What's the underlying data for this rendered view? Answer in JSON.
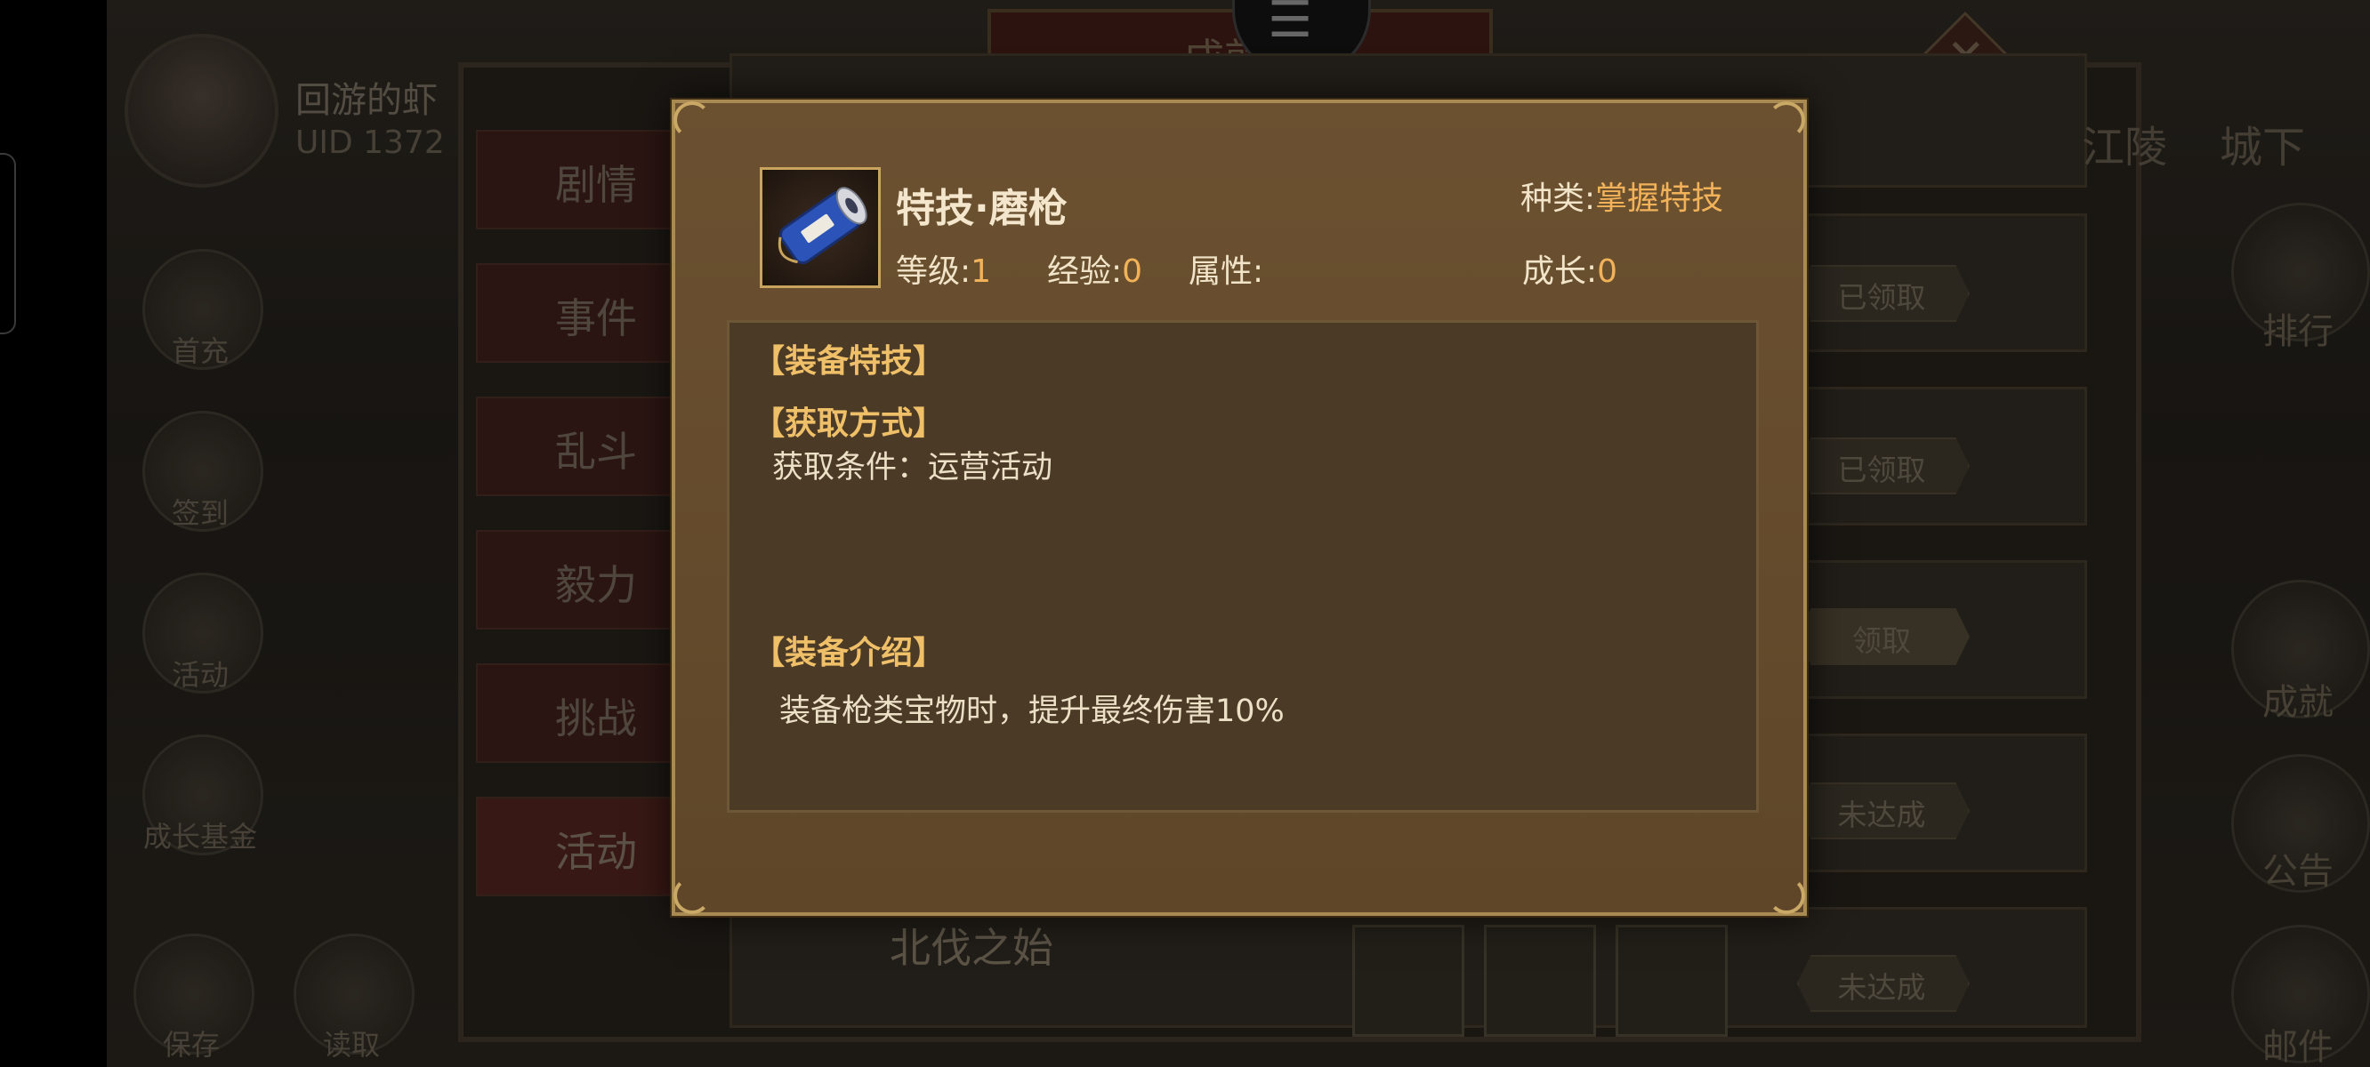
{
  "background": {
    "player": {
      "name": "回游的虾",
      "uid": "UID  1372"
    },
    "window_title": "成就",
    "tabs": [
      "剧情",
      "事件",
      "乱斗",
      "毅力",
      "挑战",
      "活动"
    ],
    "left_icons": [
      "首充",
      "签到",
      "活动",
      "成长基金"
    ],
    "bottom_buttons": [
      "保存",
      "读取"
    ],
    "right_icons": [
      "排行",
      "成就",
      "公告",
      "邮件"
    ],
    "location": [
      "江陵",
      "城下"
    ],
    "statuses": [
      "已领取",
      "已领取",
      "领取",
      "未达成",
      "未达成"
    ],
    "bottom_card_title": "北伐之始"
  },
  "popup": {
    "item_name": "特技·磨枪",
    "type_label": "种类:",
    "type_value": "掌握特技",
    "level_label": "等级:",
    "level_value": "1",
    "exp_label": "经验:",
    "exp_value": "0",
    "attr_label": "属性:",
    "growth_label": "成长:",
    "growth_value": "0",
    "sections": {
      "equip_skill": "【装备特技】",
      "obtain_method": "【获取方式】",
      "obtain_condition": "获取条件：运营活动",
      "equip_intro": "【装备介绍】",
      "intro_text": "装备枪类宝物时，提升最终伤害10%"
    }
  },
  "colors": {
    "accent": "#f2b25a",
    "section": "#f0c069",
    "popup_bg": "#5f4629"
  },
  "icons": [
    "spear-scroll-icon",
    "achievement-icon",
    "close-icon"
  ]
}
